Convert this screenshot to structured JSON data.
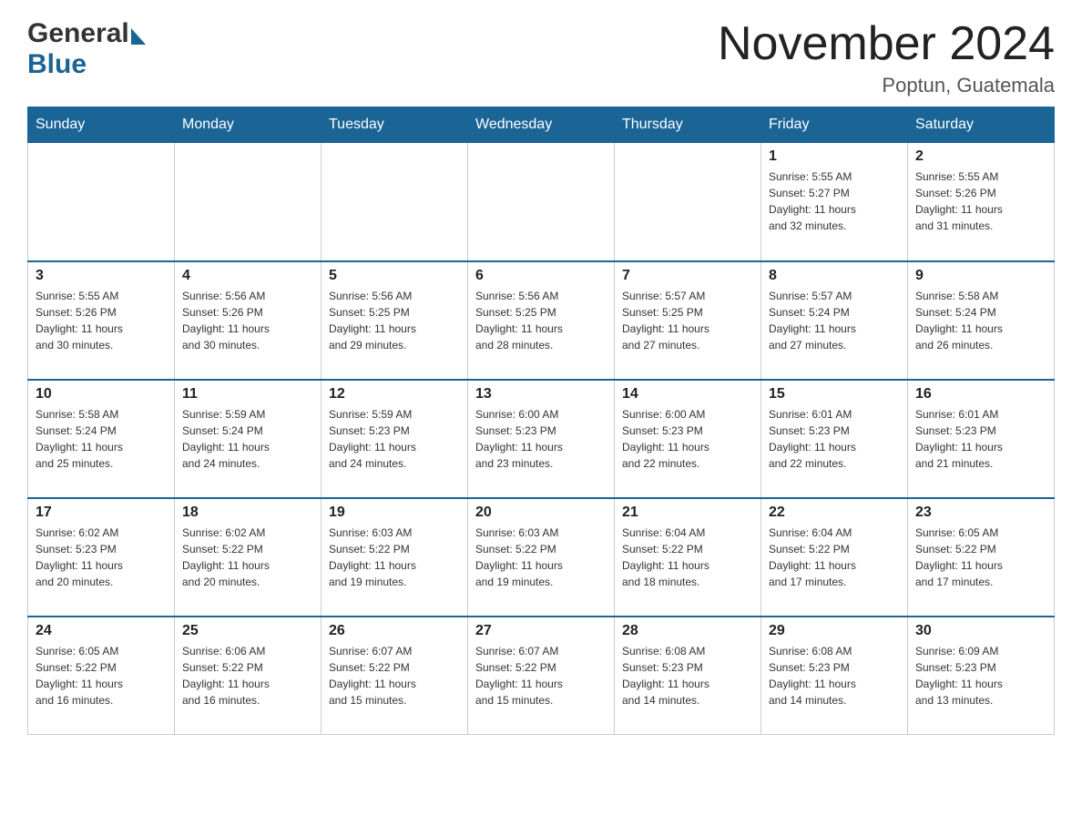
{
  "header": {
    "logo_general": "General",
    "logo_blue": "Blue",
    "month_title": "November 2024",
    "location": "Poptun, Guatemala"
  },
  "weekdays": [
    "Sunday",
    "Monday",
    "Tuesday",
    "Wednesday",
    "Thursday",
    "Friday",
    "Saturday"
  ],
  "weeks": [
    [
      {
        "day": "",
        "info": ""
      },
      {
        "day": "",
        "info": ""
      },
      {
        "day": "",
        "info": ""
      },
      {
        "day": "",
        "info": ""
      },
      {
        "day": "",
        "info": ""
      },
      {
        "day": "1",
        "info": "Sunrise: 5:55 AM\nSunset: 5:27 PM\nDaylight: 11 hours\nand 32 minutes."
      },
      {
        "day": "2",
        "info": "Sunrise: 5:55 AM\nSunset: 5:26 PM\nDaylight: 11 hours\nand 31 minutes."
      }
    ],
    [
      {
        "day": "3",
        "info": "Sunrise: 5:55 AM\nSunset: 5:26 PM\nDaylight: 11 hours\nand 30 minutes."
      },
      {
        "day": "4",
        "info": "Sunrise: 5:56 AM\nSunset: 5:26 PM\nDaylight: 11 hours\nand 30 minutes."
      },
      {
        "day": "5",
        "info": "Sunrise: 5:56 AM\nSunset: 5:25 PM\nDaylight: 11 hours\nand 29 minutes."
      },
      {
        "day": "6",
        "info": "Sunrise: 5:56 AM\nSunset: 5:25 PM\nDaylight: 11 hours\nand 28 minutes."
      },
      {
        "day": "7",
        "info": "Sunrise: 5:57 AM\nSunset: 5:25 PM\nDaylight: 11 hours\nand 27 minutes."
      },
      {
        "day": "8",
        "info": "Sunrise: 5:57 AM\nSunset: 5:24 PM\nDaylight: 11 hours\nand 27 minutes."
      },
      {
        "day": "9",
        "info": "Sunrise: 5:58 AM\nSunset: 5:24 PM\nDaylight: 11 hours\nand 26 minutes."
      }
    ],
    [
      {
        "day": "10",
        "info": "Sunrise: 5:58 AM\nSunset: 5:24 PM\nDaylight: 11 hours\nand 25 minutes."
      },
      {
        "day": "11",
        "info": "Sunrise: 5:59 AM\nSunset: 5:24 PM\nDaylight: 11 hours\nand 24 minutes."
      },
      {
        "day": "12",
        "info": "Sunrise: 5:59 AM\nSunset: 5:23 PM\nDaylight: 11 hours\nand 24 minutes."
      },
      {
        "day": "13",
        "info": "Sunrise: 6:00 AM\nSunset: 5:23 PM\nDaylight: 11 hours\nand 23 minutes."
      },
      {
        "day": "14",
        "info": "Sunrise: 6:00 AM\nSunset: 5:23 PM\nDaylight: 11 hours\nand 22 minutes."
      },
      {
        "day": "15",
        "info": "Sunrise: 6:01 AM\nSunset: 5:23 PM\nDaylight: 11 hours\nand 22 minutes."
      },
      {
        "day": "16",
        "info": "Sunrise: 6:01 AM\nSunset: 5:23 PM\nDaylight: 11 hours\nand 21 minutes."
      }
    ],
    [
      {
        "day": "17",
        "info": "Sunrise: 6:02 AM\nSunset: 5:23 PM\nDaylight: 11 hours\nand 20 minutes."
      },
      {
        "day": "18",
        "info": "Sunrise: 6:02 AM\nSunset: 5:22 PM\nDaylight: 11 hours\nand 20 minutes."
      },
      {
        "day": "19",
        "info": "Sunrise: 6:03 AM\nSunset: 5:22 PM\nDaylight: 11 hours\nand 19 minutes."
      },
      {
        "day": "20",
        "info": "Sunrise: 6:03 AM\nSunset: 5:22 PM\nDaylight: 11 hours\nand 19 minutes."
      },
      {
        "day": "21",
        "info": "Sunrise: 6:04 AM\nSunset: 5:22 PM\nDaylight: 11 hours\nand 18 minutes."
      },
      {
        "day": "22",
        "info": "Sunrise: 6:04 AM\nSunset: 5:22 PM\nDaylight: 11 hours\nand 17 minutes."
      },
      {
        "day": "23",
        "info": "Sunrise: 6:05 AM\nSunset: 5:22 PM\nDaylight: 11 hours\nand 17 minutes."
      }
    ],
    [
      {
        "day": "24",
        "info": "Sunrise: 6:05 AM\nSunset: 5:22 PM\nDaylight: 11 hours\nand 16 minutes."
      },
      {
        "day": "25",
        "info": "Sunrise: 6:06 AM\nSunset: 5:22 PM\nDaylight: 11 hours\nand 16 minutes."
      },
      {
        "day": "26",
        "info": "Sunrise: 6:07 AM\nSunset: 5:22 PM\nDaylight: 11 hours\nand 15 minutes."
      },
      {
        "day": "27",
        "info": "Sunrise: 6:07 AM\nSunset: 5:22 PM\nDaylight: 11 hours\nand 15 minutes."
      },
      {
        "day": "28",
        "info": "Sunrise: 6:08 AM\nSunset: 5:23 PM\nDaylight: 11 hours\nand 14 minutes."
      },
      {
        "day": "29",
        "info": "Sunrise: 6:08 AM\nSunset: 5:23 PM\nDaylight: 11 hours\nand 14 minutes."
      },
      {
        "day": "30",
        "info": "Sunrise: 6:09 AM\nSunset: 5:23 PM\nDaylight: 11 hours\nand 13 minutes."
      }
    ]
  ]
}
